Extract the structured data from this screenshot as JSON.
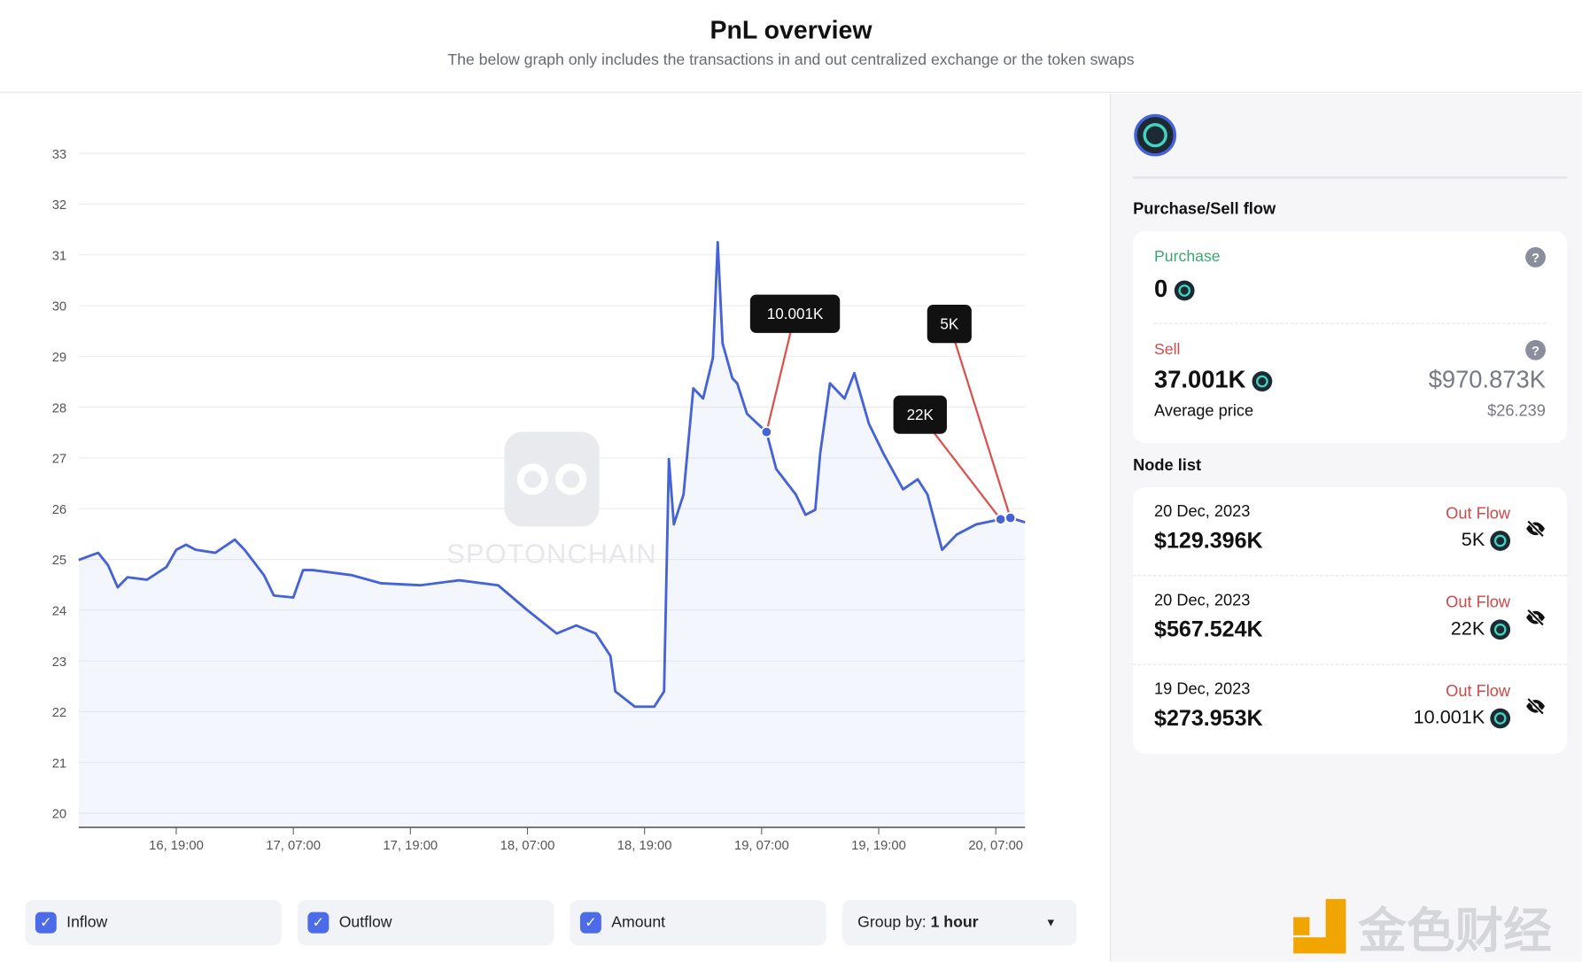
{
  "header": {
    "title": "PnL overview",
    "subtitle": "The below graph only includes the transactions in and out centralized exchange or the token swaps"
  },
  "watermark": "SPOTONCHAIN",
  "chart_data": {
    "type": "line",
    "ylim": [
      20,
      33
    ],
    "yticks": [
      20,
      21,
      22,
      23,
      24,
      25,
      26,
      27,
      28,
      29,
      30,
      31,
      32,
      33
    ],
    "xticks": [
      {
        "t": "2023-12-16T19:00",
        "label": "16, 19:00"
      },
      {
        "t": "2023-12-17T07:00",
        "label": "17, 07:00"
      },
      {
        "t": "2023-12-17T19:00",
        "label": "17, 19:00"
      },
      {
        "t": "2023-12-18T07:00",
        "label": "18, 07:00"
      },
      {
        "t": "2023-12-18T19:00",
        "label": "18, 19:00"
      },
      {
        "t": "2023-12-19T07:00",
        "label": "19, 07:00"
      },
      {
        "t": "2023-12-19T19:00",
        "label": "19, 19:00"
      },
      {
        "t": "2023-12-20T07:00",
        "label": "20, 07:00"
      }
    ],
    "color": "#4563d6",
    "grid": true,
    "points": [
      [
        "2023-12-16T09:00",
        24.99
      ],
      [
        "2023-12-16T11:00",
        25.13
      ],
      [
        "2023-12-16T12:00",
        24.89
      ],
      [
        "2023-12-16T13:00",
        24.45
      ],
      [
        "2023-12-16T14:00",
        24.65
      ],
      [
        "2023-12-16T16:00",
        24.6
      ],
      [
        "2023-12-16T18:00",
        24.85
      ],
      [
        "2023-12-16T19:00",
        25.19
      ],
      [
        "2023-12-16T20:00",
        25.29
      ],
      [
        "2023-12-16T21:00",
        25.19
      ],
      [
        "2023-12-16T23:00",
        25.13
      ],
      [
        "2023-12-17T01:00",
        25.39
      ],
      [
        "2023-12-17T02:00",
        25.19
      ],
      [
        "2023-12-17T04:00",
        24.69
      ],
      [
        "2023-12-17T05:00",
        24.29
      ],
      [
        "2023-12-17T07:00",
        24.25
      ],
      [
        "2023-12-17T08:00",
        24.79
      ],
      [
        "2023-12-17T09:00",
        24.79
      ],
      [
        "2023-12-17T13:00",
        24.69
      ],
      [
        "2023-12-17T16:00",
        24.53
      ],
      [
        "2023-12-17T20:00",
        24.49
      ],
      [
        "2023-12-18T00:00",
        24.59
      ],
      [
        "2023-12-18T04:00",
        24.49
      ],
      [
        "2023-12-18T07:00",
        24.0
      ],
      [
        "2023-12-18T10:00",
        23.54
      ],
      [
        "2023-12-18T12:00",
        23.7
      ],
      [
        "2023-12-18T14:00",
        23.54
      ],
      [
        "2023-12-18T15:30",
        23.1
      ],
      [
        "2023-12-18T16:00",
        22.4
      ],
      [
        "2023-12-18T18:00",
        22.1
      ],
      [
        "2023-12-18T20:00",
        22.1
      ],
      [
        "2023-12-18T21:00",
        22.4
      ],
      [
        "2023-12-18T21:30",
        26.98
      ],
      [
        "2023-12-18T22:00",
        25.69
      ],
      [
        "2023-12-18T23:00",
        26.28
      ],
      [
        "2023-12-19T00:00",
        28.37
      ],
      [
        "2023-12-19T01:00",
        28.17
      ],
      [
        "2023-12-19T02:00",
        28.97
      ],
      [
        "2023-12-19T02:30",
        31.25
      ],
      [
        "2023-12-19T03:00",
        29.26
      ],
      [
        "2023-12-19T04:00",
        28.57
      ],
      [
        "2023-12-19T04:30",
        28.47
      ],
      [
        "2023-12-19T05:30",
        27.87
      ],
      [
        "2023-12-19T07:30",
        27.51
      ],
      [
        "2023-12-19T08:30",
        26.78
      ],
      [
        "2023-12-19T10:30",
        26.28
      ],
      [
        "2023-12-19T11:30",
        25.88
      ],
      [
        "2023-12-19T12:30",
        25.98
      ],
      [
        "2023-12-19T13:00",
        27.08
      ],
      [
        "2023-12-19T14:00",
        28.47
      ],
      [
        "2023-12-19T15:30",
        28.17
      ],
      [
        "2023-12-19T16:30",
        28.67
      ],
      [
        "2023-12-19T18:00",
        27.67
      ],
      [
        "2023-12-19T19:30",
        27.08
      ],
      [
        "2023-12-19T21:30",
        26.38
      ],
      [
        "2023-12-19T23:00",
        26.58
      ],
      [
        "2023-12-20T00:00",
        26.28
      ],
      [
        "2023-12-20T01:30",
        25.19
      ],
      [
        "2023-12-20T03:00",
        25.49
      ],
      [
        "2023-12-20T05:00",
        25.69
      ],
      [
        "2023-12-20T07:30",
        25.79
      ],
      [
        "2023-12-20T08:30",
        25.82
      ],
      [
        "2023-12-20T10:00",
        25.73
      ]
    ],
    "annotations": [
      {
        "t": "2023-12-19T07:30",
        "y": 27.51,
        "label": "10.001K"
      },
      {
        "t": "2023-12-20T07:30",
        "y": 25.79,
        "label": "22K"
      },
      {
        "t": "2023-12-20T08:30",
        "y": 25.82,
        "label": "5K"
      }
    ]
  },
  "controls": {
    "inflow": "Inflow",
    "outflow": "Outflow",
    "amount": "Amount",
    "group_prefix": "Group by:",
    "group_value": "1 hour"
  },
  "side": {
    "flow_title": "Purchase/Sell flow",
    "purchase_label": "Purchase",
    "purchase_value": "0",
    "purchase_color": "#3aa76d",
    "sell_label": "Sell",
    "sell_value": "37.001K",
    "sell_usd": "$970.873K",
    "sell_color": "#d04848",
    "avg_label": "Average price",
    "avg_value": "$26.239",
    "node_title": "Node list",
    "nodes": [
      {
        "date": "20 Dec, 2023",
        "usd": "$129.396K",
        "type": "Out Flow",
        "amount": "5K"
      },
      {
        "date": "20 Dec, 2023",
        "usd": "$567.524K",
        "type": "Out Flow",
        "amount": "22K"
      },
      {
        "date": "19 Dec, 2023",
        "usd": "$273.953K",
        "type": "Out Flow",
        "amount": "10.001K"
      }
    ]
  },
  "logo": "金色财经"
}
